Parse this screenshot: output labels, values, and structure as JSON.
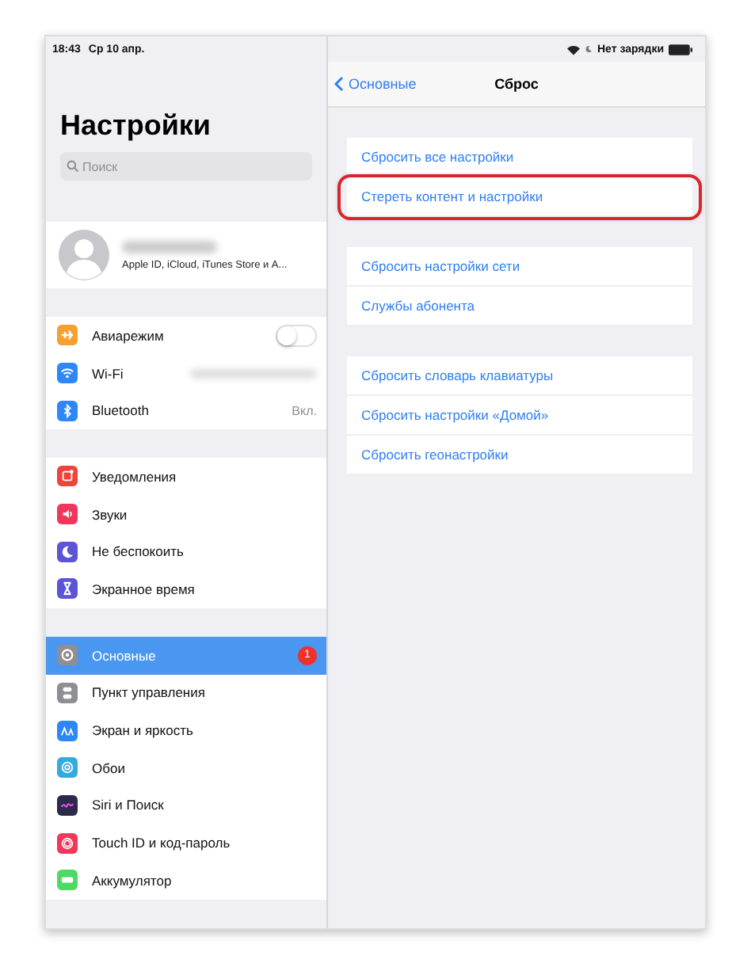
{
  "status_bar": {
    "time": "18:43",
    "date": "Ср 10 апр.",
    "charging": "Нет зарядки"
  },
  "sidebar": {
    "title": "Настройки",
    "search": {
      "placeholder": "Поиск"
    },
    "profile": {
      "subtitle": "Apple ID, iCloud, iTunes Store и А..."
    },
    "groups": [
      [
        {
          "label": "Авиарежим",
          "color": "#f5a030",
          "kind": "toggle",
          "on": false,
          "selected": false
        },
        {
          "label": "Wi-Fi",
          "color": "#2f86f6",
          "kind": "hidden",
          "selected": false
        },
        {
          "label": "Bluetooth",
          "color": "#2f86f6",
          "kind": "value",
          "value": "Вкл.",
          "selected": false
        }
      ],
      [
        {
          "label": "Уведомления",
          "color": "#f0443a",
          "kind": "plain",
          "selected": false
        },
        {
          "label": "Звуки",
          "color": "#f0365a",
          "kind": "plain",
          "selected": false
        },
        {
          "label": "Не беспокоить",
          "color": "#5b55d6",
          "kind": "plain",
          "selected": false
        },
        {
          "label": "Экранное время",
          "color": "#5b55d6",
          "kind": "plain",
          "selected": false
        }
      ],
      [
        {
          "label": "Основные",
          "color": "#8e8e93",
          "kind": "badge",
          "badge": "1",
          "selected": true
        },
        {
          "label": "Пункт управления",
          "color": "#8e8e93",
          "kind": "plain",
          "selected": false
        },
        {
          "label": "Экран и яркость",
          "color": "#2f86f6",
          "kind": "plain",
          "selected": false
        },
        {
          "label": "Обои",
          "color": "#35aadc",
          "kind": "plain",
          "selected": false
        },
        {
          "label": "Siri и Поиск",
          "color": "#2a2a4a",
          "kind": "plain",
          "selected": false
        },
        {
          "label": "Touch ID и код-пароль",
          "color": "#f0365a",
          "kind": "plain",
          "selected": false
        },
        {
          "label": "Аккумулятор",
          "color": "#4cd964",
          "kind": "plain",
          "selected": false
        }
      ]
    ]
  },
  "detail": {
    "back": "Основные",
    "title": "Сброс",
    "groups": [
      [
        {
          "label": "Сбросить все настройки",
          "highlighted": false
        },
        {
          "label": "Стереть контент и настройки",
          "highlighted": true
        }
      ],
      [
        {
          "label": "Сбросить настройки сети",
          "highlighted": false
        },
        {
          "label": "Службы абонента",
          "highlighted": false
        }
      ],
      [
        {
          "label": "Сбросить словарь клавиатуры",
          "highlighted": false
        },
        {
          "label": "Сбросить настройки «Домой»",
          "highlighted": false
        },
        {
          "label": "Сбросить геонастройки",
          "highlighted": false
        }
      ]
    ]
  }
}
